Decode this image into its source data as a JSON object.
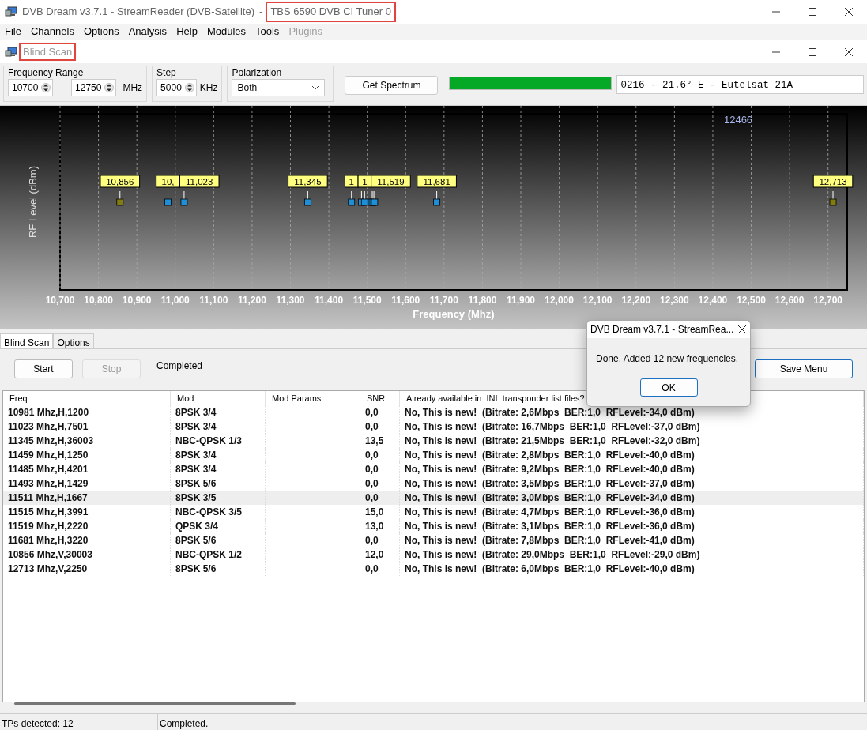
{
  "window": {
    "title": "DVB Dream v3.7.1 - StreamReader (DVB-Satellite)",
    "title_separator": "-",
    "tuner": "TBS 6590 DVB CI Tuner 0"
  },
  "menu": [
    {
      "label": "File",
      "disabled": false
    },
    {
      "label": "Channels",
      "disabled": false
    },
    {
      "label": "Options",
      "disabled": false
    },
    {
      "label": "Analysis",
      "disabled": false
    },
    {
      "label": "Help",
      "disabled": false
    },
    {
      "label": "Modules",
      "disabled": false
    },
    {
      "label": "Tools",
      "disabled": false
    },
    {
      "label": "Plugins",
      "disabled": true
    }
  ],
  "child_window": {
    "title": "Blind Scan"
  },
  "toolbar": {
    "frequency_range": {
      "label": "Frequency Range",
      "from": "10700",
      "dash": "–",
      "to": "12750",
      "unit": "MHz"
    },
    "step": {
      "label": "Step",
      "value": "5000",
      "unit": "KHz"
    },
    "polarization": {
      "label": "Polarization",
      "value": "Both"
    },
    "get_spectrum": "Get Spectrum",
    "progress": {
      "level": 1.0
    },
    "satellite": "0216 - 21.6° E - Eutelsat 21A"
  },
  "chart": {
    "cursor_readout": "12466",
    "xlabel": "Frequency (Mhz)",
    "ylabel": "RF Level (dBm)",
    "tick_labels": [
      "10,700",
      "10,800",
      "10,900",
      "11,000",
      "11,100",
      "11,200",
      "11,300",
      "11,400",
      "11,500",
      "11,600",
      "11,700",
      "11,800",
      "11,900",
      "12,000",
      "12,100",
      "12,200",
      "12,300",
      "12,400",
      "12,500",
      "12,600",
      "12,700"
    ],
    "markers": [
      {
        "label": "10,856",
        "color": "#807c10"
      },
      {
        "label": "10,",
        "color": "#1e8fd6"
      },
      {
        "label": "11,023",
        "color": "#1e8fd6"
      },
      {
        "label": "11,345",
        "color": "#1e8fd6"
      },
      {
        "label": "1",
        "color": "#1e8fd6"
      },
      {
        "color": "#1e8fd6"
      },
      {
        "label": "1",
        "color": "#1e8fd6"
      },
      {
        "color": "#1e8fd6"
      },
      {
        "color": "#1e8fd6"
      },
      {
        "label": "11,519",
        "color": "#1e8fd6"
      },
      {
        "label": "11,681",
        "color": "#1e8fd6"
      },
      {
        "label": "12,713",
        "color": "#807c10"
      }
    ]
  },
  "tabs": [
    {
      "label": "Blind Scan",
      "selected": true
    },
    {
      "label": "Options",
      "selected": false
    }
  ],
  "controls": {
    "start": {
      "label": "Start",
      "disabled": false
    },
    "stop": {
      "label": "Stop",
      "disabled": true
    },
    "status": "Completed",
    "save_menu": "Save Menu"
  },
  "table": {
    "columns": [
      "Freq",
      "Mod",
      "Mod Params",
      "SNR",
      "Already available in  INI  transponder list files?"
    ],
    "rows": [
      {
        "freq": "10981 Mhz,H,1200",
        "mod": "8PSK 3/4",
        "snr": "0,0",
        "status": "No, This is new!  (Bitrate: 2,6Mbps  BER:1,0  RFLevel:-34,0 dBm)",
        "selected": false
      },
      {
        "freq": "11023 Mhz,H,7501",
        "mod": "8PSK 3/4",
        "snr": "0,0",
        "status": "No, This is new!  (Bitrate: 16,7Mbps  BER:1,0  RFLevel:-37,0 dBm)",
        "selected": false
      },
      {
        "freq": "11345 Mhz,H,36003",
        "mod": "NBC-QPSK 1/3",
        "snr": "13,5",
        "status": "No, This is new!  (Bitrate: 21,5Mbps  BER:1,0  RFLevel:-32,0 dBm)",
        "selected": false
      },
      {
        "freq": "11459 Mhz,H,1250",
        "mod": "8PSK 3/4",
        "snr": "0,0",
        "status": "No, This is new!  (Bitrate: 2,8Mbps  BER:1,0  RFLevel:-40,0 dBm)",
        "selected": false
      },
      {
        "freq": "11485 Mhz,H,4201",
        "mod": "8PSK 3/4",
        "snr": "0,0",
        "status": "No, This is new!  (Bitrate: 9,2Mbps  BER:1,0  RFLevel:-40,0 dBm)",
        "selected": false
      },
      {
        "freq": "11493 Mhz,H,1429",
        "mod": "8PSK 5/6",
        "snr": "0,0",
        "status": "No, This is new!  (Bitrate: 3,5Mbps  BER:1,0  RFLevel:-37,0 dBm)",
        "selected": false
      },
      {
        "freq": "11511 Mhz,H,1667",
        "mod": "8PSK 3/5",
        "snr": "0,0",
        "status": "No, This is new!  (Bitrate: 3,0Mbps  BER:1,0  RFLevel:-34,0 dBm)",
        "selected": true
      },
      {
        "freq": "11515 Mhz,H,3991",
        "mod": "NBC-QPSK 3/5",
        "snr": "15,0",
        "status": "No, This is new!  (Bitrate: 4,7Mbps  BER:1,0  RFLevel:-36,0 dBm)",
        "selected": false
      },
      {
        "freq": "11519 Mhz,H,2220",
        "mod": "QPSK 3/4",
        "snr": "13,0",
        "status": "No, This is new!  (Bitrate: 3,1Mbps  BER:1,0  RFLevel:-36,0 dBm)",
        "selected": false
      },
      {
        "freq": "11681 Mhz,H,3220",
        "mod": "8PSK 5/6",
        "snr": "0,0",
        "status": "No, This is new!  (Bitrate: 7,8Mbps  BER:1,0  RFLevel:-41,0 dBm)",
        "selected": false
      },
      {
        "freq": "10856 Mhz,V,30003",
        "mod": "NBC-QPSK 1/2",
        "snr": "12,0",
        "status": "No, This is new!  (Bitrate: 29,0Mbps  BER:1,0  RFLevel:-29,0 dBm)",
        "selected": false
      },
      {
        "freq": "12713 Mhz,V,2250",
        "mod": "8PSK 5/6",
        "snr": "0,0",
        "status": "No, This is new!  (Bitrate: 6,0Mbps  BER:1,0  RFLevel:-40,0 dBm)",
        "selected": false
      }
    ]
  },
  "status_bar": [
    "TPs detected: 12",
    "Completed."
  ],
  "dialog": {
    "title": "DVB Dream v3.7.1 - StreamRea...",
    "message": "Done.  Added 12 new frequencies.",
    "button": "OK"
  }
}
